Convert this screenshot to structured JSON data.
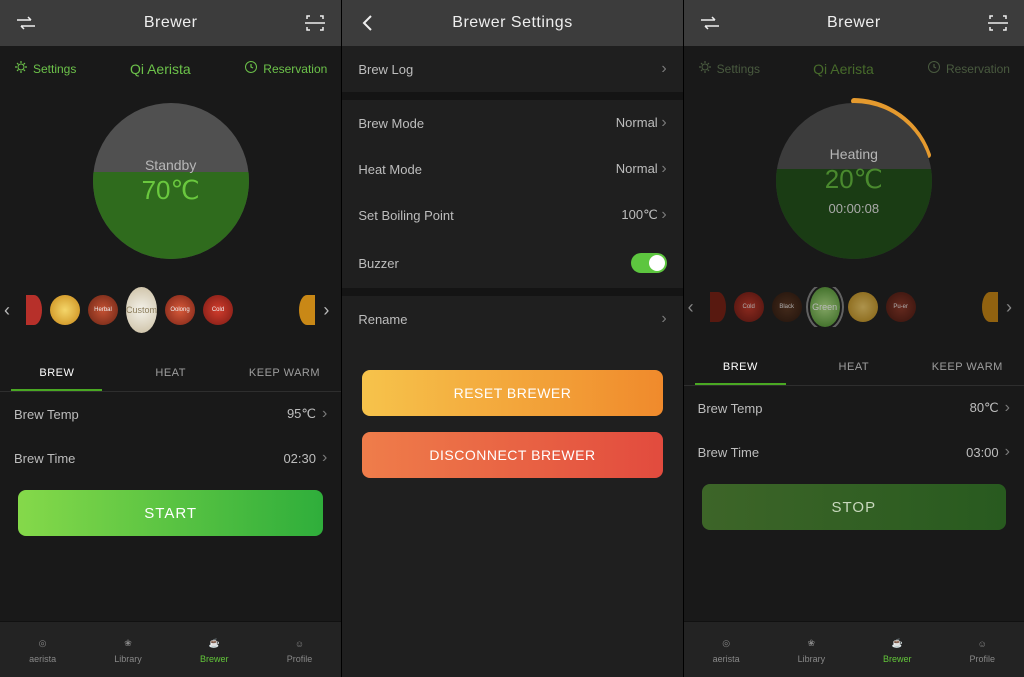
{
  "s1": {
    "title": "Brewer",
    "settings_label": "Settings",
    "device": "Qi Aerista",
    "reservation_label": "Reservation",
    "dial": {
      "status": "Standby",
      "temp": "70℃"
    },
    "chips_center_label": "Custom",
    "chips_other": [
      "",
      "",
      "Herbal",
      "Oolong",
      "Cold",
      ""
    ],
    "tabs": {
      "brew": "BREW",
      "heat": "HEAT",
      "keepwarm": "KEEP WARM"
    },
    "brew_temp_label": "Brew Temp",
    "brew_temp_value": "95℃",
    "brew_time_label": "Brew Time",
    "brew_time_value": "02:30",
    "start_label": "START",
    "tabbar": {
      "aerista": "aerista",
      "library": "Library",
      "brewer": "Brewer",
      "profile": "Profile"
    }
  },
  "s2": {
    "title": "Brewer Settings",
    "brew_log": "Brew Log",
    "brew_mode_label": "Brew Mode",
    "brew_mode_value": "Normal",
    "heat_mode_label": "Heat Mode",
    "heat_mode_value": "Normal",
    "boiling_label": "Set Boiling Point",
    "boiling_value": "100℃",
    "buzzer_label": "Buzzer",
    "rename": "Rename",
    "reset_btn": "RESET BREWER",
    "disconnect_btn": "DISCONNECT BREWER"
  },
  "s3": {
    "title": "Brewer",
    "settings_label": "Settings",
    "device": "Qi Aerista",
    "reservation_label": "Reservation",
    "dial": {
      "status": "Heating",
      "temp": "20℃",
      "timer": "00:00:08"
    },
    "chips_center_label": "Green",
    "chips_other": [
      "",
      "Cold",
      "Black",
      "",
      "Pu-er",
      ""
    ],
    "tabs": {
      "brew": "BREW",
      "heat": "HEAT",
      "keepwarm": "KEEP WARM"
    },
    "brew_temp_label": "Brew Temp",
    "brew_temp_value": "80℃",
    "brew_time_label": "Brew Time",
    "brew_time_value": "03:00",
    "stop_label": "STOP",
    "tabbar": {
      "aerista": "aerista",
      "library": "Library",
      "brewer": "Brewer",
      "profile": "Profile"
    }
  }
}
